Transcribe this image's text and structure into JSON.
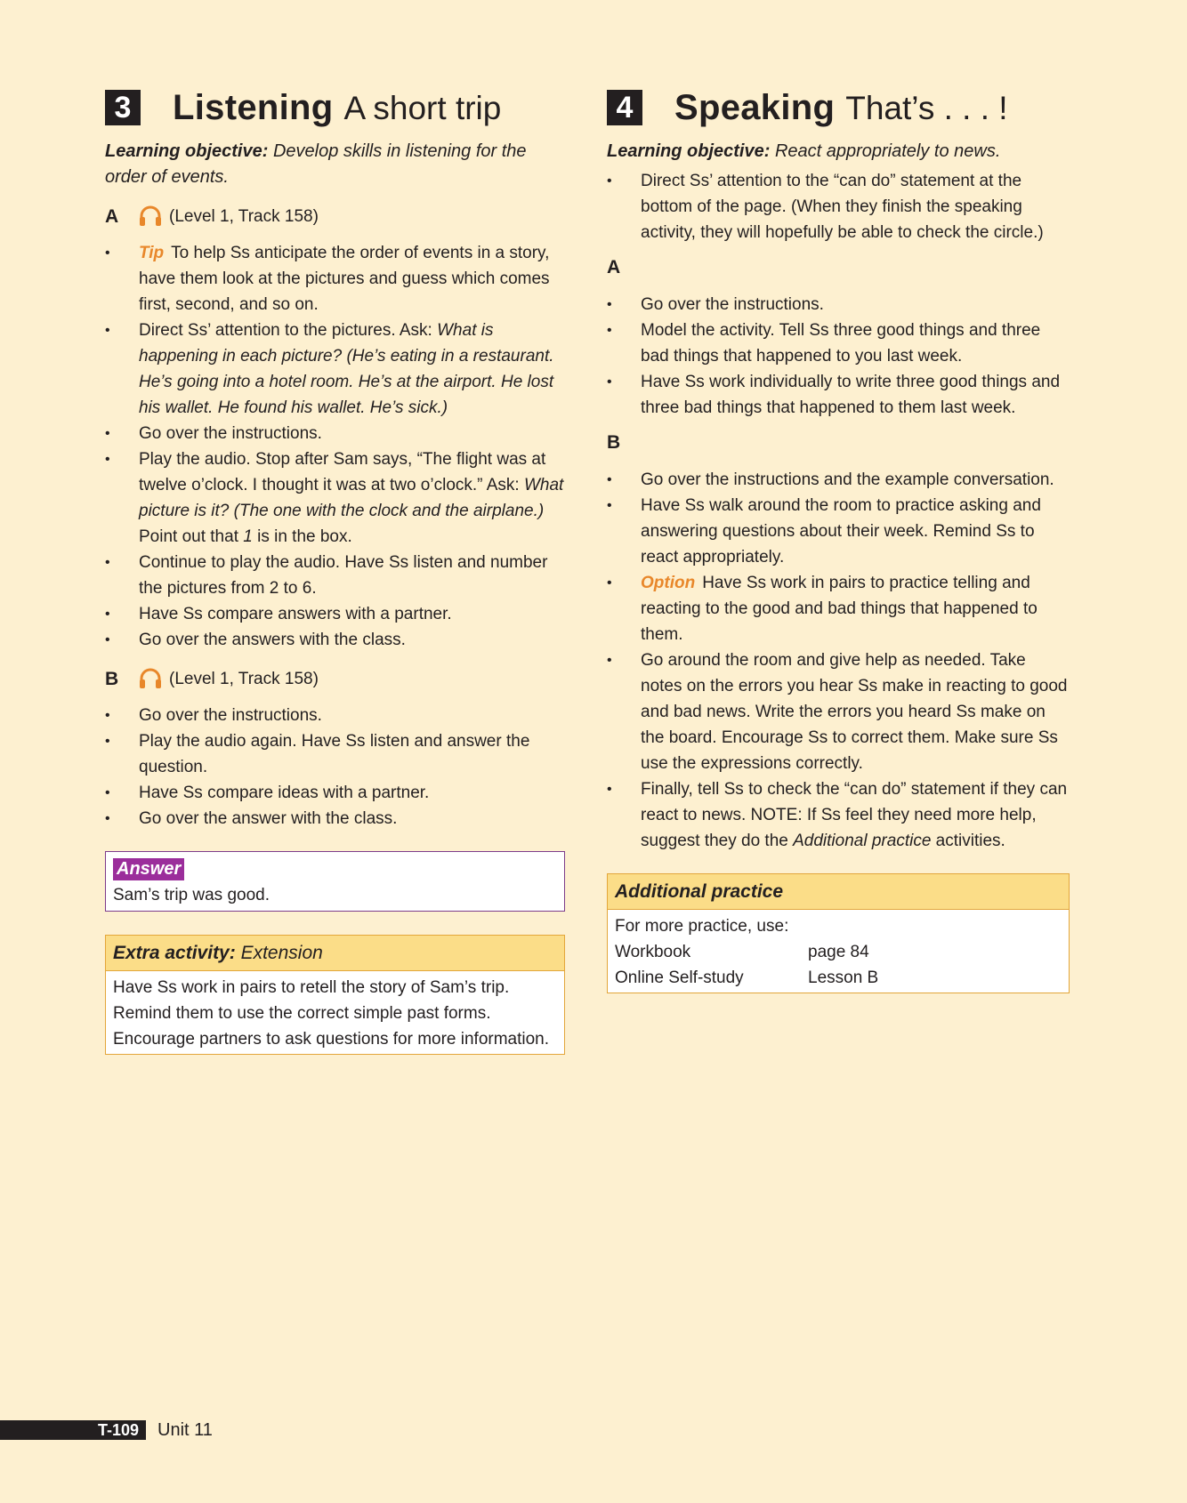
{
  "left": {
    "section_number": "3",
    "section_title": "Listening",
    "section_subtitle": "A short trip",
    "objective_label": "Learning objective:",
    "objective_text": "Develop skills in listening for the order of events.",
    "part_a": {
      "letter": "A",
      "track": "(Level 1, Track 158)"
    },
    "part_a_bullets": {
      "tip_label": "Tip",
      "tip_text": "To help Ss anticipate the order of events in a story, have them look at the pictures and guess which comes first, second, and so on.",
      "b2_plain": "Direct Ss’ attention to the pictures. Ask: ",
      "b2_italic": "What is happening in each picture? (He’s eating in a restaurant. He’s going into a hotel room. He’s at the airport. He lost his wallet. He found his wallet. He’s sick.)",
      "b3": "Go over the instructions.",
      "b4_plain1": "Play the audio. Stop after Sam says, “The flight was at twelve o’clock. I thought it was at two o’clock.” Ask: ",
      "b4_italic": "What picture is it? (The one with the clock and the airplane.)",
      "b4_plain2": " Point out that ",
      "b4_num": "1",
      "b4_plain3": " is in the box.",
      "b5": "Continue to play the audio. Have Ss listen and number the pictures from 2 to 6.",
      "b6": "Have Ss compare answers with a partner.",
      "b7": "Go over the answers with the class."
    },
    "part_b": {
      "letter": "B",
      "track": "(Level 1, Track 158)"
    },
    "part_b_bullets": [
      "Go over the instructions.",
      "Play the audio again. Have Ss listen and answer the question.",
      "Have Ss compare ideas with a partner.",
      "Go over the answer with the class."
    ],
    "answer": {
      "label": "Answer",
      "text": "Sam’s trip was good."
    },
    "extra": {
      "title_bold": "Extra activity:",
      "title_rest": "Extension",
      "lines": [
        "Have Ss work in pairs to retell the story of Sam’s trip.",
        "Remind them to use the correct simple past forms.",
        "Encourage partners to ask questions for more information."
      ]
    }
  },
  "right": {
    "section_number": "4",
    "section_title": "Speaking",
    "section_subtitle": "That’s . . . !",
    "objective_label": "Learning objective:",
    "objective_text": "React appropriately to news.",
    "intro_bullet": "Direct Ss’ attention to the “can do” statement at the bottom of the page. (When they finish the speaking activity, they will hopefully be able to check the circle.)",
    "part_a_letter": "A",
    "part_a_bullets": [
      "Go over the instructions.",
      "Model the activity. Tell Ss three good things and three bad things that happened to you last week.",
      "Have Ss work individually to write three good things and three bad things that happened to them last week."
    ],
    "part_b_letter": "B",
    "part_b_bullets": {
      "b1": "Go over the instructions and the example conversation.",
      "b2": "Have Ss walk around the room to practice asking and answering questions about their week. Remind Ss to react appropriately.",
      "option_label": "Option",
      "option_text": "Have Ss work in pairs to practice telling and reacting to the good and bad things that happened to them.",
      "b4": "Go around the room and give help as needed. Take notes on the errors you hear Ss make in reacting to good and bad news. Write the errors you heard Ss make on the board. Encourage Ss to correct them. Make sure Ss use the expressions correctly.",
      "b5_plain": "Finally, tell Ss to check the “can do” statement if they can react to news. NOTE: If Ss feel they need more help, suggest they do the ",
      "b5_italic": "Additional practice",
      "b5_end": " activities."
    },
    "additional": {
      "title": "Additional practice",
      "intro": "For more practice, use:",
      "rows": [
        {
          "name": "Workbook",
          "value": "page 84"
        },
        {
          "name": "Online Self-study",
          "value": "Lesson B"
        }
      ]
    }
  },
  "footer": {
    "page": "T-109",
    "unit": "Unit 11"
  },
  "colors": {
    "accent_orange": "#e8872a",
    "answer_purple": "#9b2d9b",
    "box_yellow": "#fbdd88",
    "background": "#fdf0d0"
  }
}
